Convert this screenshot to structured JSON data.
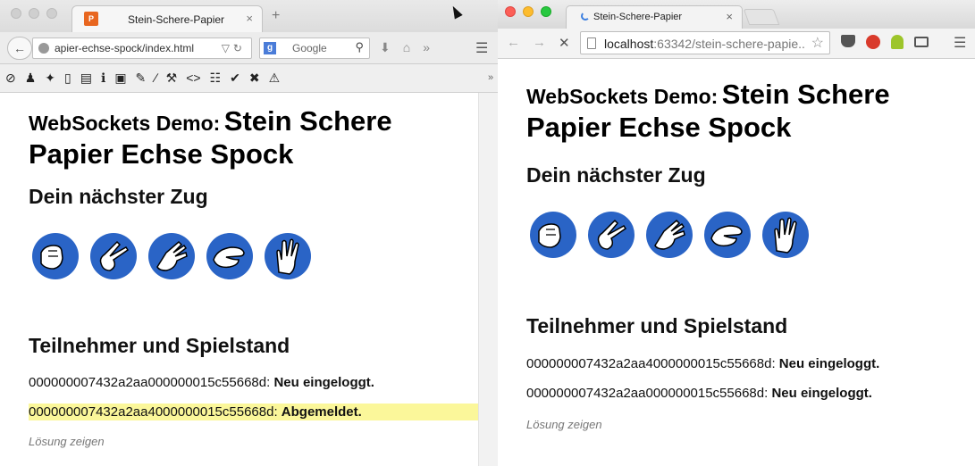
{
  "left_window": {
    "tab_title": "Stein-Schere-Papier",
    "tab_close": "×",
    "new_tab": "+",
    "url": "apier-echse-spock/index.html",
    "search_placeholder": "Google",
    "page": {
      "title_prefix": "WebSockets Demo:",
      "title_main": "Stein Schere Papier Echse Spock",
      "next_move_heading": "Dein nächster Zug",
      "participants_heading": "Teilnehmer und Spielstand",
      "players": [
        {
          "id": "000000007432a2aa000000015c55668d:",
          "status": "Neu eingeloggt."
        },
        {
          "id": "000000007432a2aa4000000015c55668d:",
          "status": "Abgemeldet."
        }
      ],
      "show_solution": "Lösung zeigen"
    }
  },
  "right_window": {
    "tab_title": "Stein-Schere-Papier",
    "tab_close": "×",
    "url_host": "localhost",
    "url_path": ":63342/stein-schere-papie...",
    "page": {
      "title_prefix": "WebSockets Demo:",
      "title_main": "Stein Schere Papier Echse Spock",
      "next_move_heading": "Dein nächster Zug",
      "participants_heading": "Teilnehmer und Spielstand",
      "players": [
        {
          "id": "000000007432a2aa4000000015c55668d:",
          "status": "Neu eingeloggt."
        },
        {
          "id": "000000007432a2aa000000015c55668d:",
          "status": "Neu eingeloggt."
        }
      ],
      "show_solution": "Lösung zeigen"
    }
  },
  "gestures": [
    "rock-hand-icon",
    "scissors-hand-icon",
    "paper-hand-icon",
    "lizard-hand-icon",
    "spock-hand-icon"
  ],
  "colors": {
    "gesture_circle": "#2a64c6",
    "highlight": "#fbf79a",
    "link_grey": "#777777"
  }
}
